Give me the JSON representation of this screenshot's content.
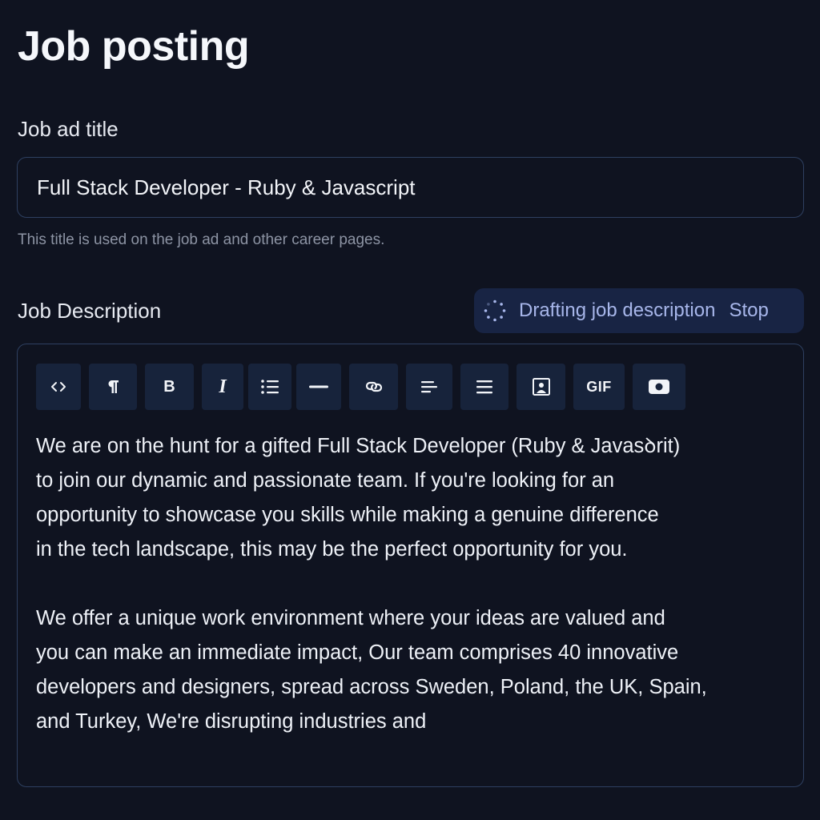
{
  "page": {
    "title": "Job posting"
  },
  "job_title_field": {
    "label": "Job ad title",
    "value": "Full Stack Developer - Ruby & Javascript",
    "helper": "This title is used on the job ad and other career pages."
  },
  "description": {
    "label": "Job Description",
    "status": {
      "text": "Drafting job description",
      "stop_label": "Stop",
      "icon": "spinner-icon"
    },
    "toolbar": [
      {
        "name": "code",
        "icon": "code-icon"
      },
      {
        "name": "paragraph",
        "icon": "pilcrow-icon"
      },
      {
        "name": "bold",
        "label": "B"
      },
      {
        "name": "italic",
        "label": "I"
      },
      {
        "name": "bullet-list",
        "icon": "bullet-list-icon"
      },
      {
        "name": "horizontal-rule",
        "icon": "horizontal-rule-icon"
      },
      {
        "name": "link",
        "icon": "link-icon"
      },
      {
        "name": "align-left",
        "icon": "align-left-icon"
      },
      {
        "name": "align-justify",
        "icon": "align-justify-icon"
      },
      {
        "name": "image",
        "icon": "image-icon"
      },
      {
        "name": "gif",
        "label": "GIF"
      },
      {
        "name": "video",
        "icon": "video-icon"
      }
    ],
    "paragraphs": [
      "We are on the hunt for a gifted Full Stack Developer (Ruby & Javasꝺrit)\nto join our dynamic and passionate team. If you're looking for an\nopportunity to showcase you skills while making a genuine difference\nin the tech landscape, this may be the perfect opportunity for you.",
      "We offer a unique work environment where your ideas are valued and\nyou can make an immediate impact, Our team comprises 40 innovative\ndevelopers and designers, spread across Sweden, Poland, the UK, Spain,\nand Turkey, We're disrupting industries and"
    ]
  },
  "colors": {
    "background": "#0f1320",
    "border": "#2e4061",
    "toolbar_button": "#17233b",
    "status_pill": "#182444",
    "status_text": "#a7b6ea",
    "helper_text": "#8d94a4"
  }
}
